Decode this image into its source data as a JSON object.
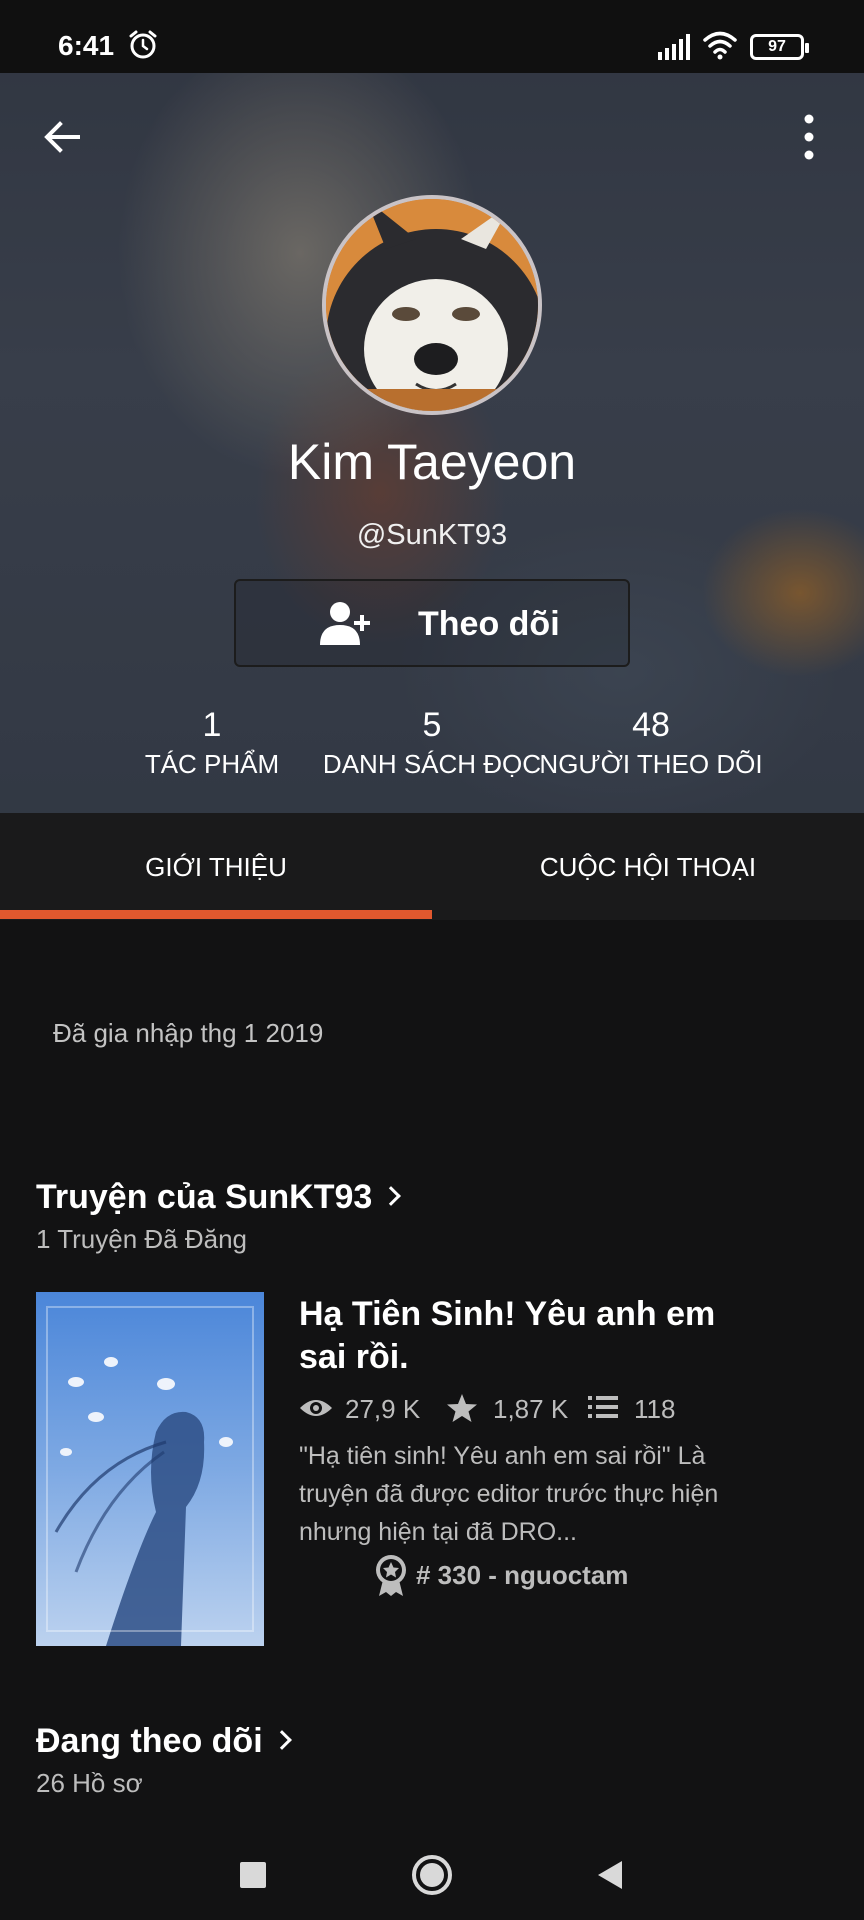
{
  "status_bar": {
    "time": "6:41",
    "battery": "97",
    "icons": [
      "alarm-icon",
      "signal-icon",
      "wifi-icon",
      "battery-icon"
    ]
  },
  "header": {
    "icons": [
      "back-arrow-icon",
      "more-vert-icon"
    ]
  },
  "profile": {
    "name": "Kim Taeyeon",
    "handle": "@SunKT93",
    "follow_label": "Theo dõi",
    "stats": [
      {
        "value": "1",
        "label": "TÁC PHẨM"
      },
      {
        "value": "5",
        "label": "DANH SÁCH ĐỌC"
      },
      {
        "value": "48",
        "label": "NGƯỜI THEO DÕI"
      }
    ]
  },
  "tabs": [
    {
      "label": "GIỚI THIỆU",
      "active": true
    },
    {
      "label": "CUỘC HỘI THOẠI",
      "active": false
    }
  ],
  "about": {
    "joined": "Đã gia nhập thg 1 2019"
  },
  "stories_section": {
    "title": "Truyện của SunKT93",
    "subtitle": "1 Truyện Đã Đăng",
    "story": {
      "title": "Hạ Tiên Sinh! Yêu anh em sai rồi.",
      "reads": "27,9 K",
      "votes": "1,87 K",
      "parts": "118",
      "description": "\"Hạ tiên sinh! Yêu anh em sai rồi\" Là truyện đã được editor trước thực hiện nhưng hiện tại đã DRO...",
      "rank": "# 330 - nguoctam"
    }
  },
  "following_section": {
    "title": "Đang theo dõi",
    "subtitle": "26 Hồ sơ"
  },
  "colors": {
    "accent": "#e1582e",
    "background": "#121213",
    "tab_bar": "#1a1a1b"
  }
}
